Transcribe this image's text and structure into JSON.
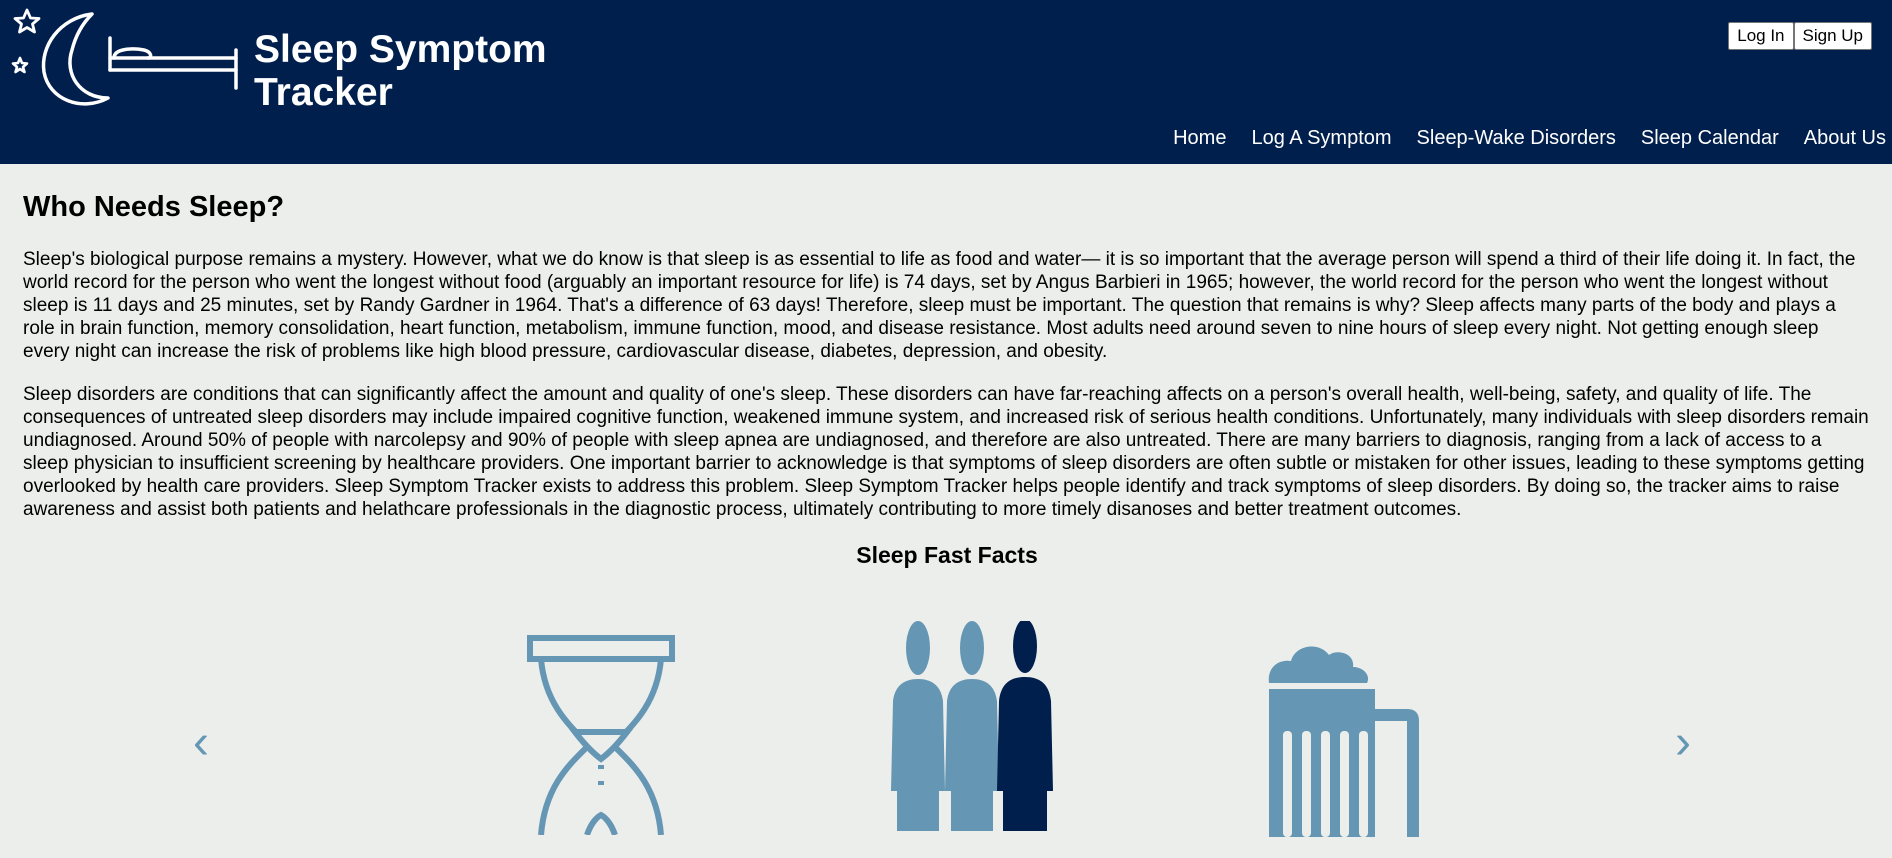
{
  "header": {
    "logo_icon": "moon-bed-stars-icon",
    "brand_title": "Sleep Symptom Tracker",
    "auth": {
      "login_label": "Log In",
      "signup_label": "Sign Up"
    },
    "nav": [
      {
        "label": "Home"
      },
      {
        "label": "Log A Symptom"
      },
      {
        "label": "Sleep-Wake Disorders"
      },
      {
        "label": "Sleep Calendar"
      },
      {
        "label": "About Us"
      }
    ]
  },
  "main": {
    "title": "Who Needs Sleep?",
    "paragraphs": [
      "Sleep's biological purpose remains a mystery. However, what we do know is that sleep is as essential to life as food and water— it is so important that the average person will spend a third of their life doing it. In fact, the world record for the person who went the longest without food (arguably an important resource for life) is 74 days, set by Angus Barbieri in 1965; however, the world record for the person who went the longest without sleep is 11 days and 25 minutes, set by Randy Gardner in 1964. That's a difference of 63 days! Therefore, sleep must be important. The question that remains is why? Sleep affects many parts of the body and plays a role in brain function, memory consolidation, heart function, metabolism, immune function, mood, and disease resistance. Most adults need around seven to nine hours of sleep every night. Not getting enough sleep every night can increase the risk of problems like high blood pressure, cardiovascular disease, diabetes, depression, and obesity.",
      "Sleep disorders are conditions that can significantly affect the amount and quality of one's sleep. These disorders can have far-reaching affects on a person's overall health, well-being, safety, and quality of life. The consequences of untreated sleep disorders may include impaired cognitive function, weakened immune system, and increased risk of serious health conditions. Unfortunately, many individuals with sleep disorders remain undiagnosed. Around 50% of people with narcolepsy and 90% of people with sleep apnea are undiagnosed, and therefore are also untreated. There are many barriers to diagnosis, ranging from a lack of access to a sleep physician to insufficient screening by healthcare providers. One important barrier to acknowledge is that symptoms of sleep disorders are often subtle or mistaken for other issues, leading to these symptoms getting overlooked by health care providers. Sleep Symptom Tracker exists to address this problem. Sleep Symptom Tracker helps people identify and track symptoms of sleep disorders. By doing so, the tracker aims to raise awareness and assist both patients and helathcare professionals in the diagnostic process, ultimately contributing to more timely disanoses and better treatment outcomes."
    ],
    "facts_title": "Sleep Fast Facts",
    "carousel": {
      "prev_label": "‹",
      "next_label": "›",
      "icons": [
        "hourglass-icon",
        "three-people-icon",
        "beer-mug-icon"
      ]
    }
  },
  "colors": {
    "header_bg": "#001f4d",
    "page_bg": "#eceeec",
    "icon_light": "#6597b4",
    "icon_dark": "#001f4d"
  }
}
